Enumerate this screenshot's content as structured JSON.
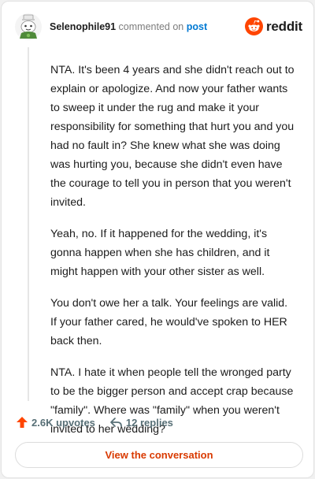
{
  "comment": {
    "username": "Selenophile91",
    "verb": "commented on",
    "target": "post",
    "paragraphs": [
      "NTA. It's been 4 years and she didn't reach out to explain or apologize. And now your father wants to sweep it under the rug and make it your responsibility for something that hurt you and you had no fault in? She knew what she was doing was hurting you, because she didn't even have the courage to tell you in person that you weren't invited.",
      "Yeah, no. If it happened for the wedding, it's gonna happen when she has children, and it might happen with your other sister as well.",
      "You don't owe her a talk. Your feelings are valid. If your father cared, he would've spoken to HER back then.",
      "NTA. I hate it when people tell the wronged party to be the bigger person and accept crap because \"family\". Where was \"family\" when you weren't invited to her wedding?"
    ]
  },
  "brand": {
    "wordmark": "reddit",
    "color": "#ff4500"
  },
  "actions": {
    "upvotes": "2.6K upvotes",
    "replies": "12 replies",
    "upvote_icon": "upvote-arrow-icon",
    "reply_icon": "reply-arrow-icon"
  },
  "cta": {
    "label": "View the conversation",
    "color": "#d93a00"
  },
  "colors": {
    "link": "#0079d3",
    "muted": "#576f76"
  }
}
